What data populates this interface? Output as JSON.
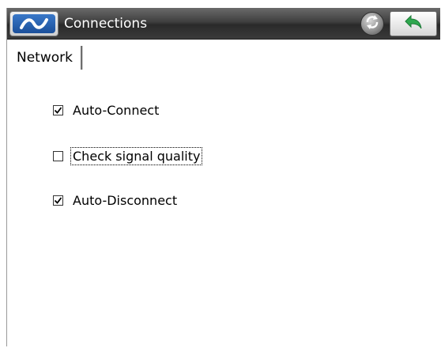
{
  "titlebar": {
    "title": "Connections",
    "logo_icon": "brand-logo-icon",
    "sync_icon": "sync-icon",
    "back_icon": "back-arrow-icon"
  },
  "tabs": [
    {
      "label": "Network",
      "selected": true
    }
  ],
  "options": [
    {
      "label": "Auto-Connect",
      "checked": true
    },
    {
      "label": "Check signal quality",
      "checked": false,
      "focused": true
    },
    {
      "label": "Auto-Disconnect",
      "checked": true
    }
  ],
  "colors": {
    "titlebar_bg": "#3f3f3f",
    "title_text": "#ffffff",
    "logo_blue": "#1b4f9a",
    "back_arrow_green": "#2fa84f"
  }
}
